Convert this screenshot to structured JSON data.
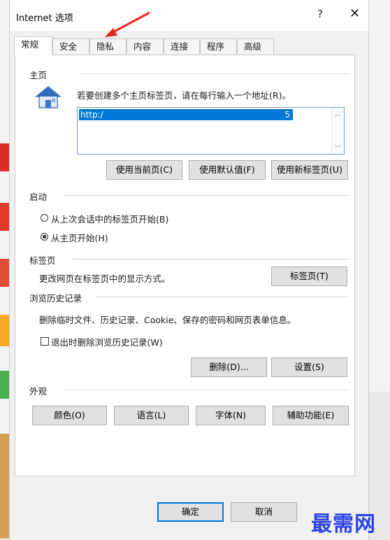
{
  "window": {
    "title": "Internet 选项",
    "help": "?",
    "close": "✕"
  },
  "tabs": [
    {
      "label": "常规",
      "active": true
    },
    {
      "label": "安全"
    },
    {
      "label": "隐私"
    },
    {
      "label": "内容"
    },
    {
      "label": "连接"
    },
    {
      "label": "程序"
    },
    {
      "label": "高级"
    }
  ],
  "home": {
    "heading": "主页",
    "description": "若要创建多个主页标签页，请在每行输入一个地址(R)。",
    "url_value": "http:/",
    "url_suffix": "5",
    "buttons": {
      "use_current": "使用当前页(C)",
      "use_default": "使用默认值(F)",
      "use_new_tab": "使用新标签页(U)"
    }
  },
  "startup": {
    "heading": "启动",
    "option_last_session": "从上次会话中的标签页开始(B)",
    "option_home": "从主页开始(H)",
    "selected": "home"
  },
  "tabs_section": {
    "heading": "标签页",
    "description": "更改网页在标签页中的显示方式。",
    "button": "标签页(T)"
  },
  "history": {
    "heading": "浏览历史记录",
    "description": "删除临时文件、历史记录、Cookie、保存的密码和网页表单信息。",
    "checkbox_label": "退出时删除浏览历史记录(W)",
    "checkbox_checked": false,
    "delete_button": "删除(D)...",
    "settings_button": "设置(S)"
  },
  "appearance": {
    "heading": "外观",
    "colors": "颜色(O)",
    "languages": "语言(L)",
    "fonts": "字体(N)",
    "accessibility": "辅助功能(E)"
  },
  "footer": {
    "ok": "确定",
    "cancel": "取消"
  },
  "watermark": "最需网",
  "colors": {
    "selection": "#0078d7",
    "annotation_arrow": "#e8281e",
    "watermark": "#2b44e8"
  }
}
